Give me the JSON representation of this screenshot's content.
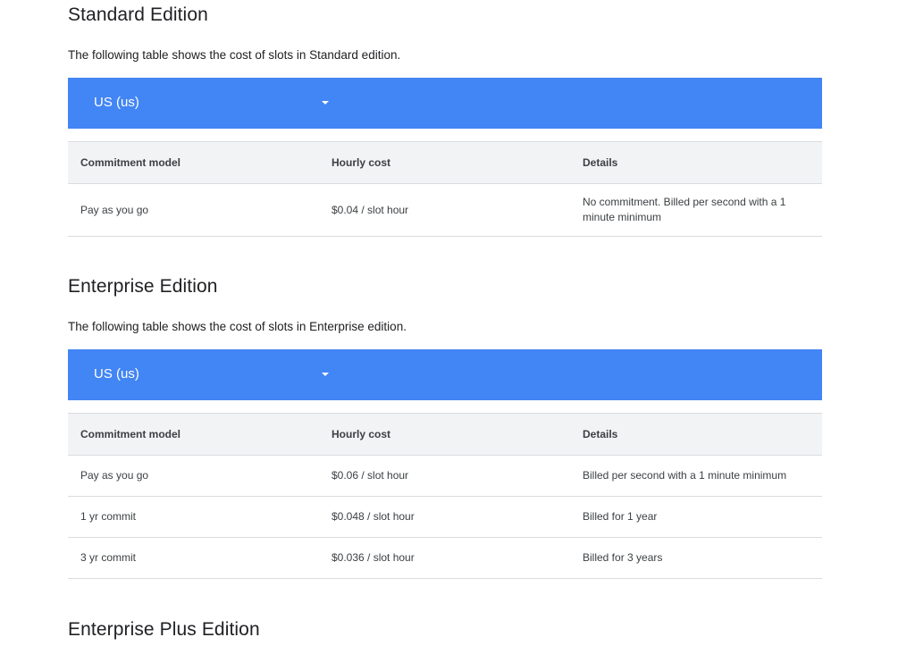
{
  "standard": {
    "title": "Standard Edition",
    "description": "The following table shows the cost of slots in Standard edition.",
    "region": {
      "label": "US (us)",
      "icon": "chevron-down-icon"
    },
    "columns": [
      "Commitment model",
      "Hourly cost",
      "Details"
    ],
    "rows": [
      {
        "model": "Pay as you go",
        "cost": "$0.04 / slot hour",
        "details": "No commitment. Billed per second with a 1 minute minimum"
      }
    ]
  },
  "enterprise": {
    "title": "Enterprise Edition",
    "description": "The following table shows the cost of slots in Enterprise edition.",
    "region": {
      "label": "US (us)",
      "icon": "chevron-down-icon"
    },
    "columns": [
      "Commitment model",
      "Hourly cost",
      "Details"
    ],
    "rows": [
      {
        "model": "Pay as you go",
        "cost": "$0.06 / slot hour",
        "details": "Billed per second with a 1 minute minimum"
      },
      {
        "model": "1 yr commit",
        "cost": "$0.048 / slot hour",
        "details": "Billed for 1 year"
      },
      {
        "model": "3 yr commit",
        "cost": "$0.036 / slot hour",
        "details": "Billed for 3 years"
      }
    ]
  },
  "enterprise_plus": {
    "title": "Enterprise Plus Edition"
  },
  "colors": {
    "region_bar": "#4285f4",
    "header_row": "#f1f3f4",
    "divider": "#dadce0"
  }
}
